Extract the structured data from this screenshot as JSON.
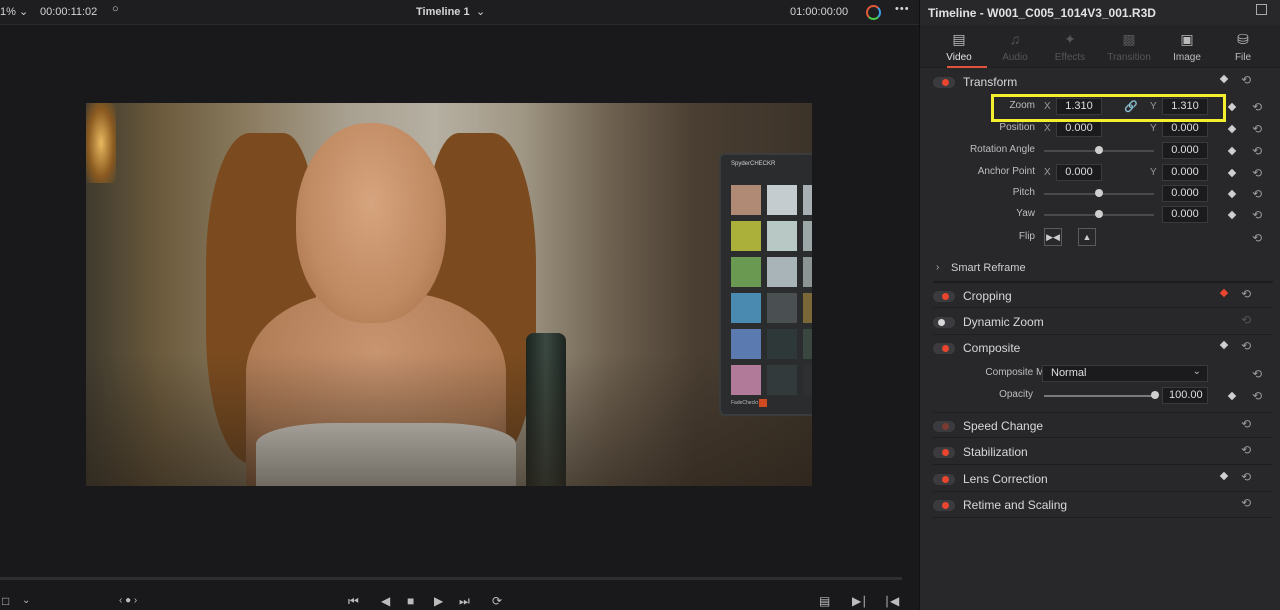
{
  "viewer": {
    "zoom_label": "1%",
    "timecode_left": "00:00:11:02",
    "timeline_title": "Timeline 1",
    "timecode_right": "01:00:00:00",
    "more": "•••"
  },
  "image": {
    "checker_brand": "SpyderCHECKR",
    "checker_footer": "FadeCheckr"
  },
  "inspector": {
    "title": "Timeline - W001_C005_1014V3_001.R3D",
    "tabs": [
      {
        "label": "Video",
        "icon": "film-icon",
        "active": true,
        "disabled": false
      },
      {
        "label": "Audio",
        "icon": "music-icon",
        "active": false,
        "disabled": true
      },
      {
        "label": "Effects",
        "icon": "wand-icon",
        "active": false,
        "disabled": true
      },
      {
        "label": "Transition",
        "icon": "transition-icon",
        "active": false,
        "disabled": true
      },
      {
        "label": "Image",
        "icon": "image-icon",
        "active": false,
        "disabled": false
      },
      {
        "label": "File",
        "icon": "file-icon",
        "active": false,
        "disabled": false
      }
    ],
    "transform": {
      "title": "Transform",
      "zoom_label": "Zoom",
      "zoom_x": "1.310",
      "zoom_y": "1.310",
      "position_label": "Position",
      "position_x": "0.000",
      "position_y": "0.000",
      "rotation_label": "Rotation Angle",
      "rotation_value": "0.000",
      "anchor_label": "Anchor Point",
      "anchor_x": "0.000",
      "anchor_y": "0.000",
      "pitch_label": "Pitch",
      "pitch_value": "0.000",
      "yaw_label": "Yaw",
      "yaw_value": "0.000",
      "flip_label": "Flip",
      "x_axis": "X",
      "y_axis": "Y"
    },
    "smart_reframe": "Smart Reframe",
    "cropping": "Cropping",
    "dynamic_zoom": "Dynamic Zoom",
    "composite": {
      "title": "Composite",
      "mode_label": "Composite Mode",
      "mode_value": "Normal",
      "opacity_label": "Opacity",
      "opacity_value": "100.00"
    },
    "speed_change": "Speed Change",
    "stabilization": "Stabilization",
    "lens_correction": "Lens Correction",
    "retime": "Retime and Scaling"
  },
  "colors": {
    "accent": "#e9452f",
    "highlight": "#f4ef2e"
  }
}
